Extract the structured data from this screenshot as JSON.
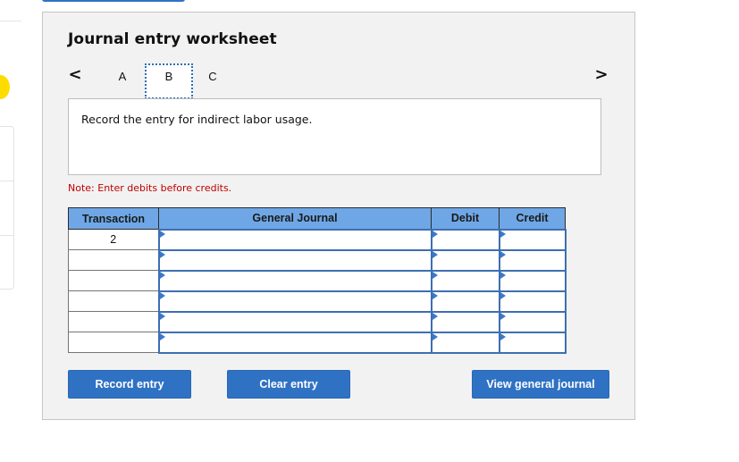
{
  "worksheet": {
    "title": "Journal entry worksheet",
    "nav": {
      "prev_icon": "chevron-left-icon",
      "next_icon": "chevron-right-icon",
      "prev_glyph": "<",
      "next_glyph": ">"
    },
    "tabs": [
      {
        "label": "A",
        "active": false
      },
      {
        "label": "B",
        "active": true
      },
      {
        "label": "C",
        "active": false
      }
    ],
    "prompt": "Record the entry for indirect labor usage.",
    "note": "Note: Enter debits before credits.",
    "table": {
      "headers": [
        "Transaction",
        "General Journal",
        "Debit",
        "Credit"
      ],
      "rows": [
        {
          "transaction": "2",
          "account": "",
          "debit": "",
          "credit": ""
        },
        {
          "transaction": "",
          "account": "",
          "debit": "",
          "credit": ""
        },
        {
          "transaction": "",
          "account": "",
          "debit": "",
          "credit": ""
        },
        {
          "transaction": "",
          "account": "",
          "debit": "",
          "credit": ""
        },
        {
          "transaction": "",
          "account": "",
          "debit": "",
          "credit": ""
        },
        {
          "transaction": "",
          "account": "",
          "debit": "",
          "credit": ""
        }
      ]
    },
    "buttons": {
      "record": "Record entry",
      "clear": "Clear entry",
      "view": "View general journal"
    }
  },
  "colors": {
    "accent": "#2f72c4",
    "header_bg": "#6fa7e6",
    "note_text": "#c00000",
    "panel_bg": "#f2f2f2"
  }
}
